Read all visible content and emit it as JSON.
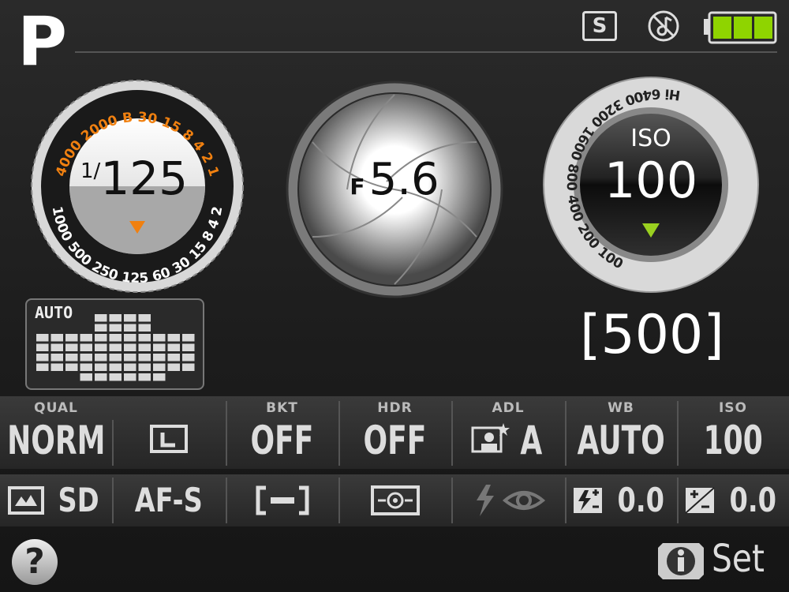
{
  "header": {
    "mode": "P",
    "scene_badge": "S",
    "beep_icon": "beep-off-icon",
    "battery_level": 1.0
  },
  "shutter": {
    "prefix": "1/",
    "value": "125",
    "scale_top": [
      "4000",
      "2000",
      "B",
      "30",
      "15",
      "8",
      "4",
      "2",
      "1"
    ],
    "scale_bottom": [
      "1000",
      "500",
      "250",
      "125",
      "60",
      "30",
      "15",
      "8",
      "4",
      "2"
    ],
    "accent": "#f08010"
  },
  "aperture": {
    "prefix": "F",
    "value": "5.6"
  },
  "iso_dial": {
    "label": "ISO",
    "value": "100",
    "scale": [
      "Hi",
      "6400",
      "3200",
      "1600",
      "800",
      "400",
      "200",
      "100"
    ],
    "accent": "#9ad020"
  },
  "af_area": {
    "label": "AUTO"
  },
  "frames_remaining": "[500]",
  "settings_row1": [
    {
      "label": "QUAL",
      "value": "NORM"
    },
    {
      "label": "",
      "value": "L",
      "icon": "image-size-large-icon"
    },
    {
      "label": "BKT",
      "value": "OFF"
    },
    {
      "label": "HDR",
      "value": "OFF"
    },
    {
      "label": "ADL",
      "value": "A",
      "icon": "active-d-lighting-icon"
    },
    {
      "label": "WB",
      "value": "AUTO"
    },
    {
      "label": "ISO",
      "value": "100"
    }
  ],
  "settings_row2": [
    {
      "value": "SD",
      "icon": "picture-control-icon"
    },
    {
      "value": "AF-S"
    },
    {
      "value": "",
      "icon": "af-area-mode-icon"
    },
    {
      "value": "",
      "icon": "metering-matrix-icon"
    },
    {
      "value": "",
      "icon": "flash-red-eye-icon"
    },
    {
      "value": "0.0",
      "icon": "flash-compensation-icon"
    },
    {
      "value": "0.0",
      "icon": "exposure-compensation-icon"
    }
  ],
  "footer": {
    "help": "?",
    "set_label": "Set"
  }
}
